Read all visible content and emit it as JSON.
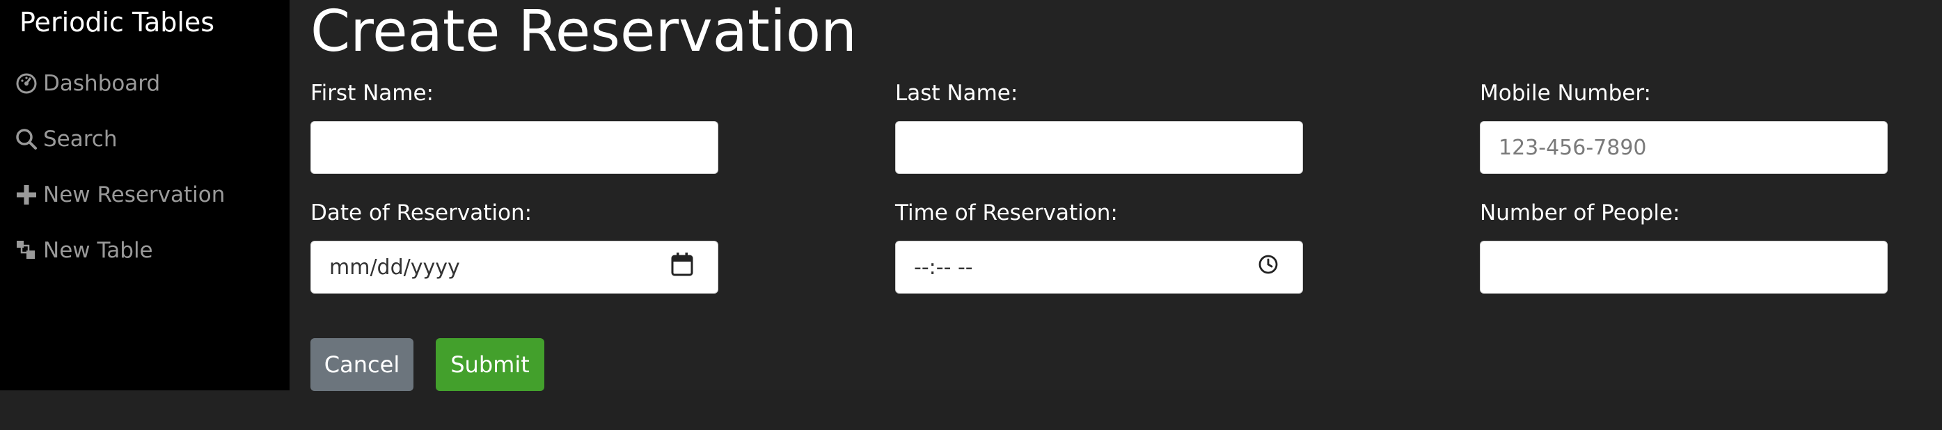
{
  "sidebar": {
    "brand": "Periodic Tables",
    "items": [
      {
        "label": "Dashboard",
        "icon": "dashboard-icon"
      },
      {
        "label": "Search",
        "icon": "search-icon"
      },
      {
        "label": "New Reservation",
        "icon": "plus-icon"
      },
      {
        "label": "New Table",
        "icon": "layers-icon"
      }
    ]
  },
  "main": {
    "title": "Create Reservation",
    "fields": {
      "first_name": {
        "label": "First Name:",
        "value": "",
        "placeholder": ""
      },
      "last_name": {
        "label": "Last Name:",
        "value": "",
        "placeholder": ""
      },
      "mobile_number": {
        "label": "Mobile Number:",
        "value": "",
        "placeholder": "123-456-7890"
      },
      "reservation_date": {
        "label": "Date of Reservation:",
        "value": "",
        "placeholder": "mm/dd/yyyy"
      },
      "reservation_time": {
        "label": "Time of Reservation:",
        "value": "",
        "placeholder": "--:-- --"
      },
      "people": {
        "label": "Number of People:",
        "value": "",
        "placeholder": ""
      }
    },
    "buttons": {
      "cancel": "Cancel",
      "submit": "Submit"
    }
  },
  "colors": {
    "sidebar_bg": "#000000",
    "page_bg": "#232323",
    "cancel_bg": "#6c757d",
    "submit_bg": "#43a02c",
    "nav_text": "#9a9a9a"
  }
}
